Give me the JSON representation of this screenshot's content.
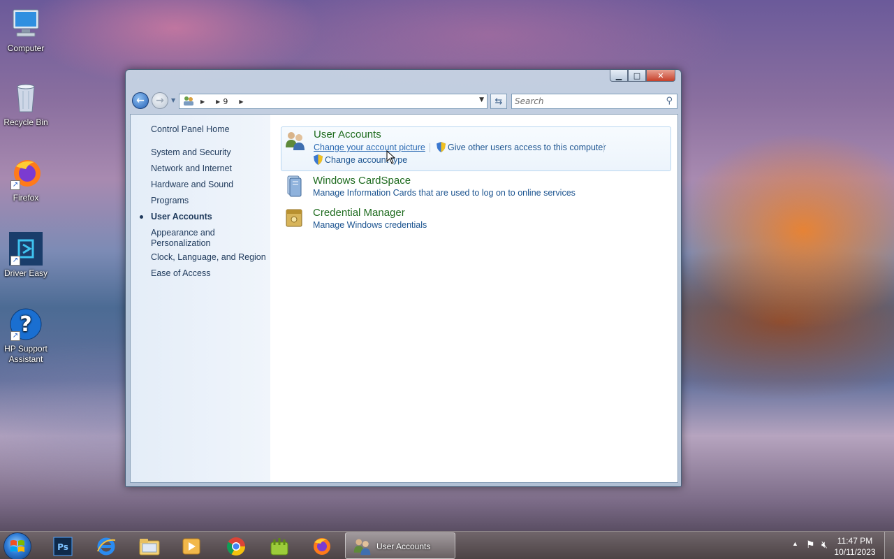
{
  "desktop": {
    "icons": [
      {
        "label": "Computer",
        "icon": "computer-icon"
      },
      {
        "label": "Recycle Bin",
        "icon": "recycle-bin-icon"
      },
      {
        "label": "Firefox",
        "icon": "firefox-icon"
      },
      {
        "label": "Driver Easy",
        "icon": "driver-easy-icon"
      },
      {
        "label": "HP Support\nAssistant",
        "icon": "help-icon"
      }
    ]
  },
  "window": {
    "buttons": {
      "minimize": "minimize-icon",
      "maximize": "maximize-icon",
      "close": "close-icon"
    },
    "address": {
      "segment": "9"
    },
    "search": {
      "placeholder": "Search"
    },
    "left_pane": {
      "home": "Control Panel Home",
      "items": [
        "System and Security",
        "Network and Internet",
        "Hardware and Sound",
        "Programs",
        "User Accounts",
        "Appearance and Personalization",
        "Clock, Language, and Region",
        "Ease of Access"
      ],
      "active": "User Accounts"
    },
    "categories": [
      {
        "title": "User Accounts",
        "links": [
          "Change your account picture",
          "Give other users access to this computer",
          "Change account type"
        ]
      },
      {
        "title": "Windows CardSpace",
        "links": [
          "Manage Information Cards that are used to log on to online services"
        ]
      },
      {
        "title": "Credential Manager",
        "links": [
          "Manage Windows credentials"
        ]
      }
    ]
  },
  "taskbar": {
    "apps": [
      "photoshop-icon",
      "internet-explorer-icon",
      "file-explorer-icon",
      "media-player-icon",
      "chrome-icon",
      "app-icon",
      "firefox-icon"
    ],
    "active_window": "User Accounts",
    "clock": {
      "time": "11:47 PM",
      "date": "10/11/2023"
    }
  },
  "colors": {
    "link": "#1c5490",
    "category_title": "#1e6b1e"
  }
}
